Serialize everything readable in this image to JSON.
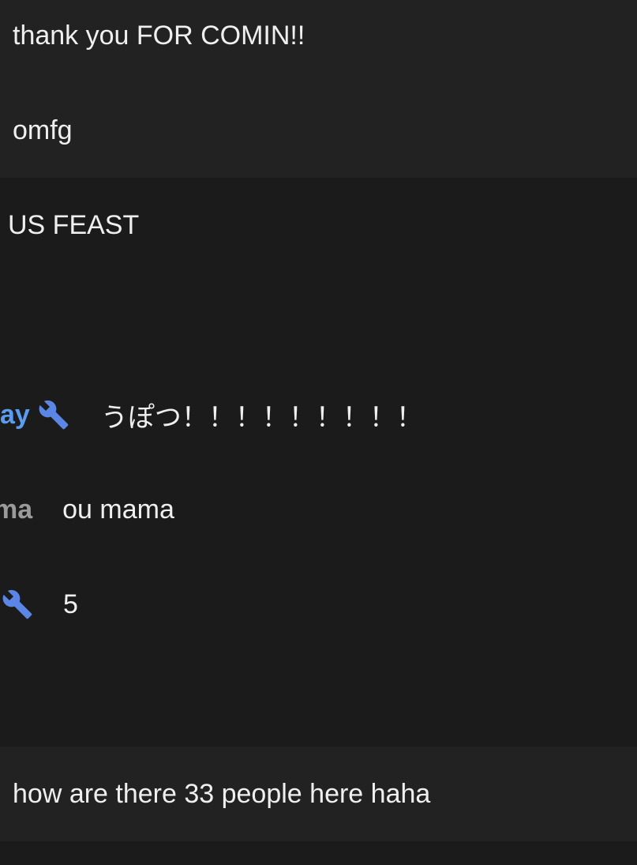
{
  "messages": [
    {
      "text": "thank you FOR COMIN!!"
    },
    {
      "text": "omfg"
    },
    {
      "text": "US FEAST"
    },
    {
      "text": ""
    },
    {
      "author": "ay",
      "badge": "wrench-icon",
      "text": "うぽつ！！！！！！！！！"
    },
    {
      "author": "ma",
      "text": "ou mama"
    },
    {
      "author": "",
      "badge": "wrench-icon",
      "text": "5"
    },
    {
      "text": ""
    },
    {
      "text": "how are there 33 people here haha"
    }
  ],
  "colors": {
    "background": "#1b1b1b",
    "alt_row": "#222222",
    "moderator_name": "#5b9cf0",
    "member_name": "#9a9a9a",
    "text": "#efefef"
  }
}
